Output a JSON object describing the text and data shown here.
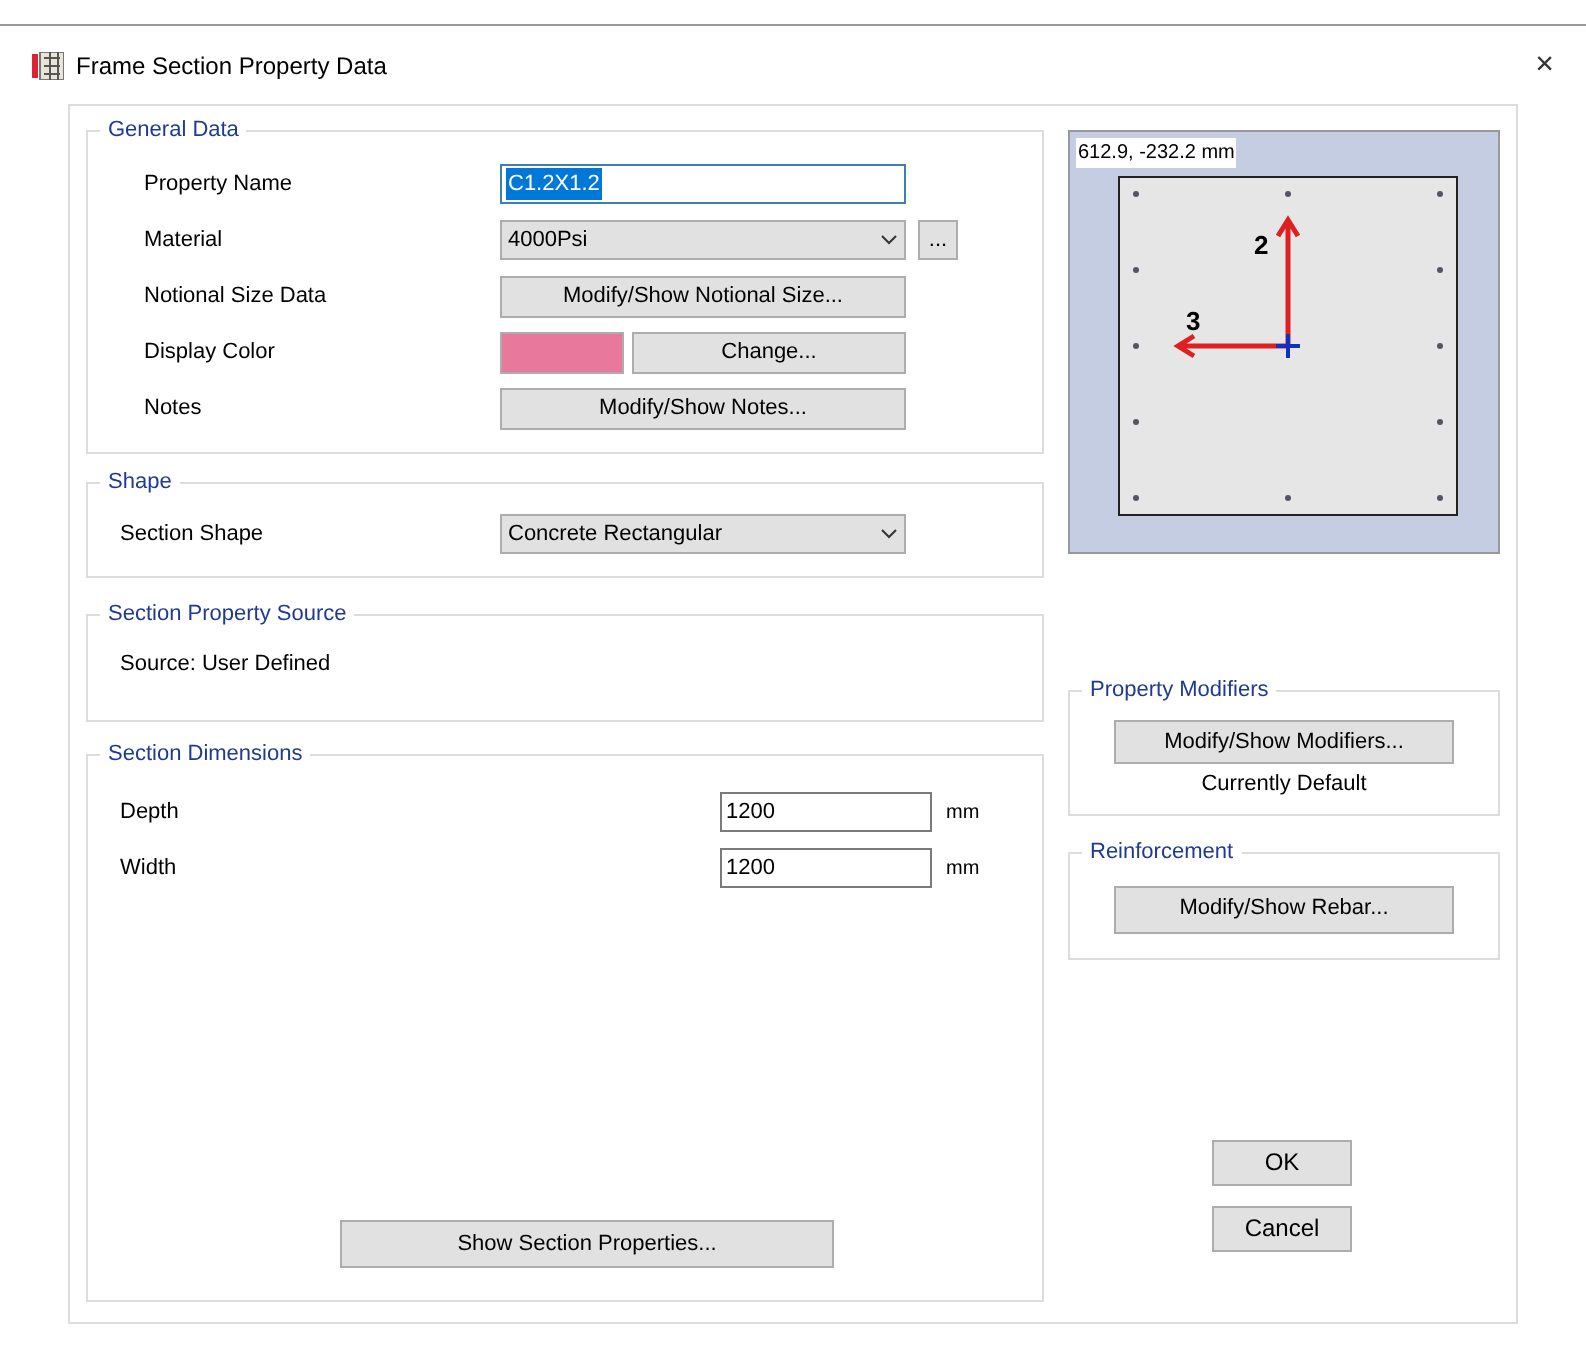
{
  "window": {
    "title": "Frame Section Property Data",
    "close": "×"
  },
  "general_data": {
    "title": "General Data",
    "rows": [
      {
        "kind": "text",
        "label": "Property Name",
        "value": "C1.2X1.2",
        "text_selected": true
      },
      {
        "kind": "dropdown",
        "label": "Material",
        "value": "4000Psi",
        "extra": "..."
      },
      {
        "kind": "button",
        "label": "Notional Size Data",
        "button": "Modify/Show Notional Size..."
      },
      {
        "kind": "color",
        "label": "Display Color",
        "color": "#e8799c",
        "button": "Change..."
      },
      {
        "kind": "button",
        "label": "Notes",
        "button": "Modify/Show Notes..."
      }
    ]
  },
  "shape": {
    "title": "Shape",
    "label": "Section Shape",
    "value": "Concrete Rectangular"
  },
  "source": {
    "title": "Section Property Source",
    "text": "Source:  User Defined"
  },
  "dimensions": {
    "title": "Section Dimensions",
    "rows": [
      {
        "label": "Depth",
        "value": "1200",
        "unit": "mm"
      },
      {
        "label": "Width",
        "value": "1200",
        "unit": "mm"
      }
    ]
  },
  "show_properties_button": "Show Section Properties...",
  "preview": {
    "coordinates": "612.9, -232.2 mm",
    "axis_2": "2",
    "axis_3": "3"
  },
  "property_modifiers": {
    "title": "Property Modifiers",
    "button": "Modify/Show Modifiers...",
    "status": "Currently Default"
  },
  "reinforcement": {
    "title": "Reinforcement",
    "button": "Modify/Show Rebar..."
  },
  "buttons": [
    "OK",
    "Cancel"
  ]
}
